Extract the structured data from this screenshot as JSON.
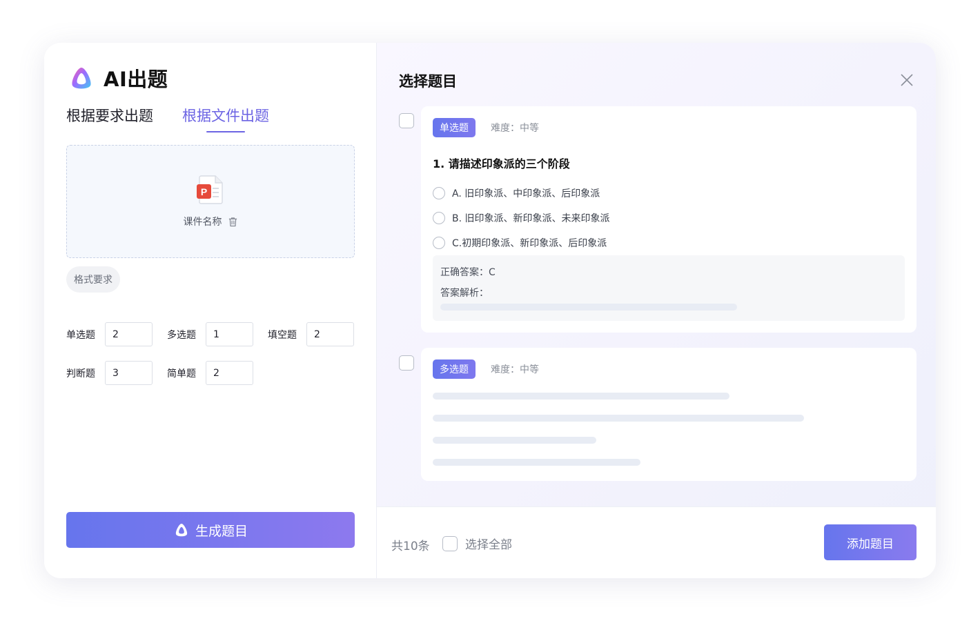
{
  "app": {
    "title": "AI出题"
  },
  "tabs": [
    {
      "label": "根据要求出题",
      "active": false
    },
    {
      "label": "根据文件出题",
      "active": true
    }
  ],
  "upload": {
    "file_name": "课件名称",
    "file_icon": "ppt-file-icon",
    "file_icon_letter": "P"
  },
  "format_chip": "格式要求",
  "quantities": [
    {
      "label": "单选题",
      "value": "2"
    },
    {
      "label": "多选题",
      "value": "1"
    },
    {
      "label": "填空题",
      "value": "2"
    },
    {
      "label": "判断题",
      "value": "3"
    },
    {
      "label": "简单题",
      "value": "2"
    }
  ],
  "generate_button": "生成题目",
  "right": {
    "title": "选择题目",
    "questions": [
      {
        "type": "单选题",
        "difficulty": "难度：中等",
        "text": "1. 请描述印象派的三个阶段",
        "options": [
          "A. 旧印象派、中印象派、后印象派",
          "B. 旧印象派、新印象派、未来印象派",
          "C.初期印象派、新印象派、后印象派"
        ],
        "answer": "正确答案：C",
        "analysis": "答案解析："
      },
      {
        "type": "多选题",
        "difficulty": "难度：中等"
      }
    ],
    "footer": {
      "total": "共10条",
      "select_all": "选择全部",
      "add_button": "添加题目"
    }
  },
  "colors": {
    "accent": "#6b63e3",
    "button_gradient_start": "#6675ed",
    "button_gradient_end": "#8d79ee",
    "ppt_red": "#e64a3b"
  }
}
